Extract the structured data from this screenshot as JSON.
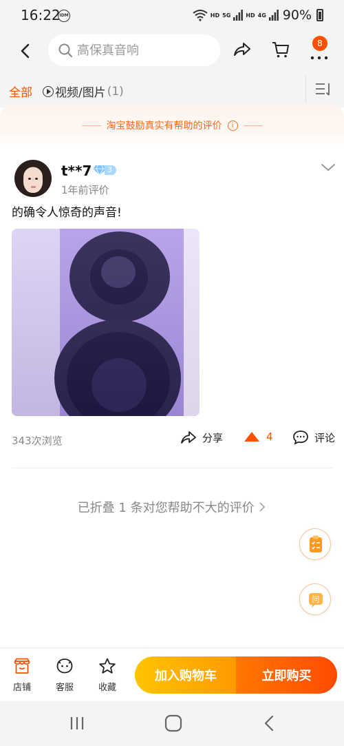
{
  "status_bar": {
    "time": "16:22",
    "notif_badge": "IDM",
    "network_1": "HD",
    "network_2": "5G",
    "network_3": "HD",
    "network_4": "4G",
    "battery": "90%"
  },
  "header": {
    "search_placeholder": "高保真音响",
    "cart_count": "8"
  },
  "tabs": {
    "all_label": "全部",
    "media_label": "视频/图片",
    "media_count": "(1)"
  },
  "banner": {
    "text": "淘宝鼓励真实有帮助的评价",
    "info_symbol": "i"
  },
  "review": {
    "username": "t**7",
    "vip_level": "3",
    "time": "1年前评价",
    "content": "的确令人惊奇的声音!",
    "views": "343次浏览",
    "share_label": "分享",
    "like_count": "4",
    "comment_label": "评论"
  },
  "folded": {
    "text": "已折叠 1 条对您帮助不大的评价"
  },
  "floating": {
    "ask_label": "问"
  },
  "bottom_bar": {
    "store_label": "店铺",
    "service_label": "客服",
    "favorite_label": "收藏",
    "add_cart_label": "加入购物车",
    "buy_now_label": "立即购买"
  },
  "colors": {
    "accent": "#ff5000",
    "cart_button": "#ffb000",
    "buy_button": "#ff5a00"
  }
}
